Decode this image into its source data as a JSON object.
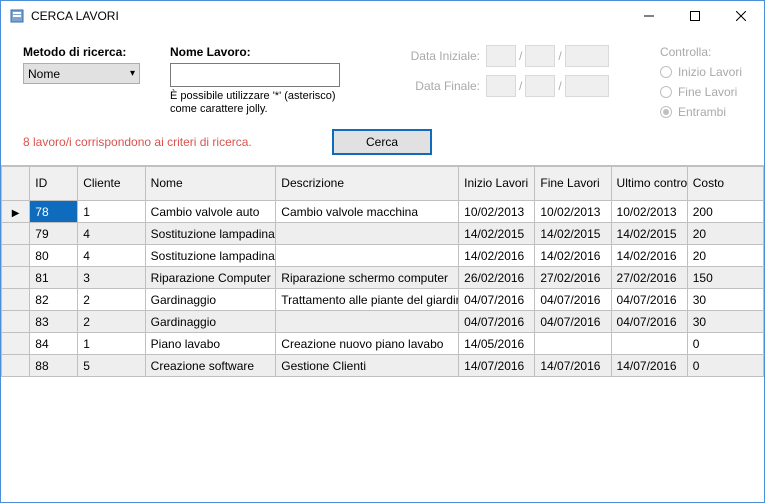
{
  "window": {
    "title": "CERCA LAVORI"
  },
  "filters": {
    "method_label": "Metodo di ricerca:",
    "method_value": "Nome",
    "name_label": "Nome Lavoro:",
    "name_value": "",
    "hint": "È possibile utilizzare '*' (asterisco) come carattere jolly.",
    "date_start_label": "Data Iniziale:",
    "date_end_label": "Data Finale:",
    "slash": "/",
    "controls_label": "Controlla:",
    "radio1": "Inizio Lavori",
    "radio2": "Fine Lavori",
    "radio3": "Entrambi"
  },
  "status": "8 lavoro/i corrispondono ai criteri di ricerca.",
  "search_label": "Cerca",
  "columns": {
    "id": "ID",
    "cliente": "Cliente",
    "nome": "Nome",
    "descrizione": "Descrizione",
    "inizio": "Inizio Lavori",
    "fine": "Fine Lavori",
    "ultimo": "Ultimo controllo",
    "costo": "Costo"
  },
  "rows": [
    {
      "id": "78",
      "cliente": "1",
      "nome": "Cambio valvole auto",
      "descrizione": "Cambio valvole macchina",
      "inizio": "10/02/2013",
      "fine": "10/02/2013",
      "ultimo": "10/02/2013",
      "costo": "200",
      "selected": true
    },
    {
      "id": "79",
      "cliente": "4",
      "nome": "Sostituzione lampadina",
      "descrizione": "",
      "inizio": "14/02/2015",
      "fine": "14/02/2015",
      "ultimo": "14/02/2015",
      "costo": "20",
      "alt": true
    },
    {
      "id": "80",
      "cliente": "4",
      "nome": "Sostituzione lampadina",
      "descrizione": "",
      "inizio": "14/02/2016",
      "fine": "14/02/2016",
      "ultimo": "14/02/2016",
      "costo": "20"
    },
    {
      "id": "81",
      "cliente": "3",
      "nome": "Riparazione Computer",
      "descrizione": "Riparazione schermo computer",
      "inizio": "26/02/2016",
      "fine": "27/02/2016",
      "ultimo": "27/02/2016",
      "costo": "150",
      "alt": true
    },
    {
      "id": "82",
      "cliente": "2",
      "nome": "Gardinaggio",
      "descrizione": "Trattamento alle piante del giardino",
      "inizio": "04/07/2016",
      "fine": "04/07/2016",
      "ultimo": "04/07/2016",
      "costo": "30"
    },
    {
      "id": "83",
      "cliente": "2",
      "nome": "Gardinaggio",
      "descrizione": "",
      "inizio": "04/07/2016",
      "fine": "04/07/2016",
      "ultimo": "04/07/2016",
      "costo": "30",
      "alt": true
    },
    {
      "id": "84",
      "cliente": "1",
      "nome": "Piano lavabo",
      "descrizione": "Creazione nuovo piano lavabo",
      "inizio": "14/05/2016",
      "fine": "",
      "ultimo": "",
      "costo": "0"
    },
    {
      "id": "88",
      "cliente": "5",
      "nome": "Creazione software",
      "descrizione": "Gestione Clienti",
      "inizio": "14/07/2016",
      "fine": "14/07/2016",
      "ultimo": "14/07/2016",
      "costo": "0",
      "alt": true
    }
  ]
}
